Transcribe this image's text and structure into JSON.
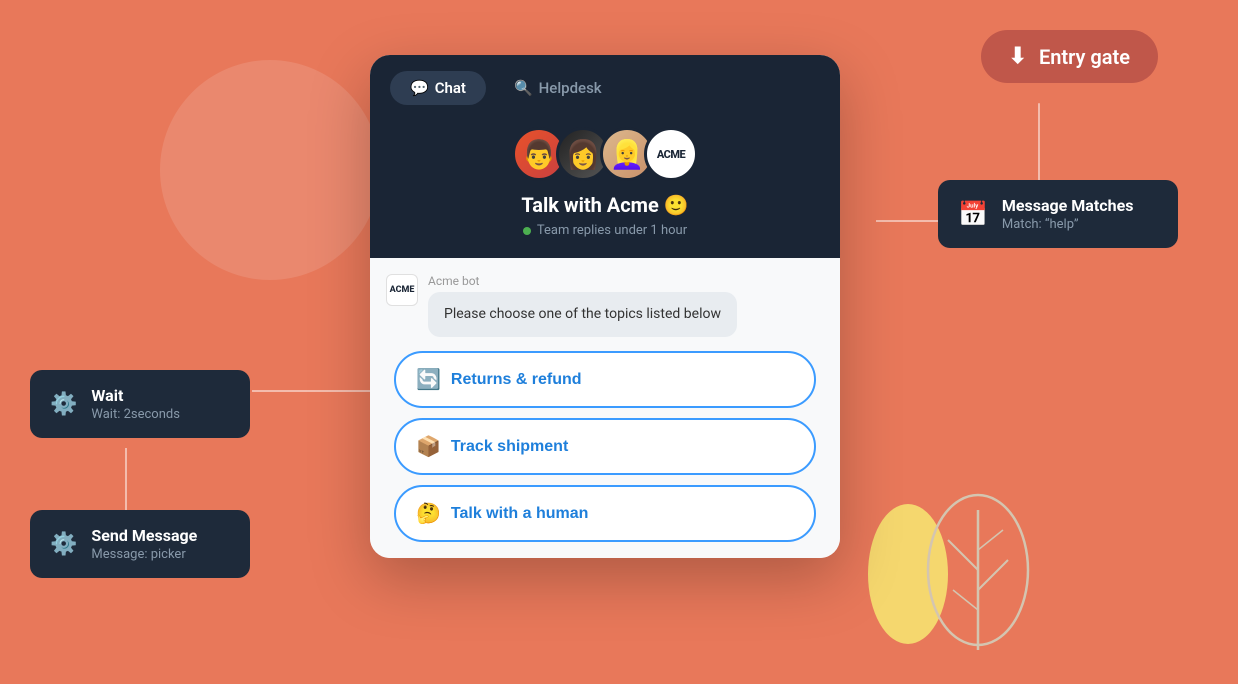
{
  "background": {
    "color": "#E8785A"
  },
  "entry_gate": {
    "label": "Entry gate",
    "icon": "⬇"
  },
  "message_matches": {
    "title": "Message Matches",
    "subtitle": "Match: “help”"
  },
  "wait_card": {
    "title": "Wait",
    "subtitle": "Wait: 2seconds"
  },
  "send_message_card": {
    "title": "Send Message",
    "subtitle": "Message: picker"
  },
  "chat_widget": {
    "tab_chat": "💬 Chat",
    "tab_helpdesk": "🔍 Helpdesk",
    "title": "Talk with Acme 🙂",
    "status": "Team replies under 1 hour",
    "bot_name": "Acme bot",
    "bot_message": "Please choose one of the topics listed below",
    "acme_label": "ACME",
    "options": [
      {
        "emoji": "🔄",
        "label": "Returns & refund"
      },
      {
        "emoji": "📦",
        "label": "Track shipment"
      },
      {
        "emoji": "🤔",
        "label": "Talk with a human"
      }
    ]
  }
}
